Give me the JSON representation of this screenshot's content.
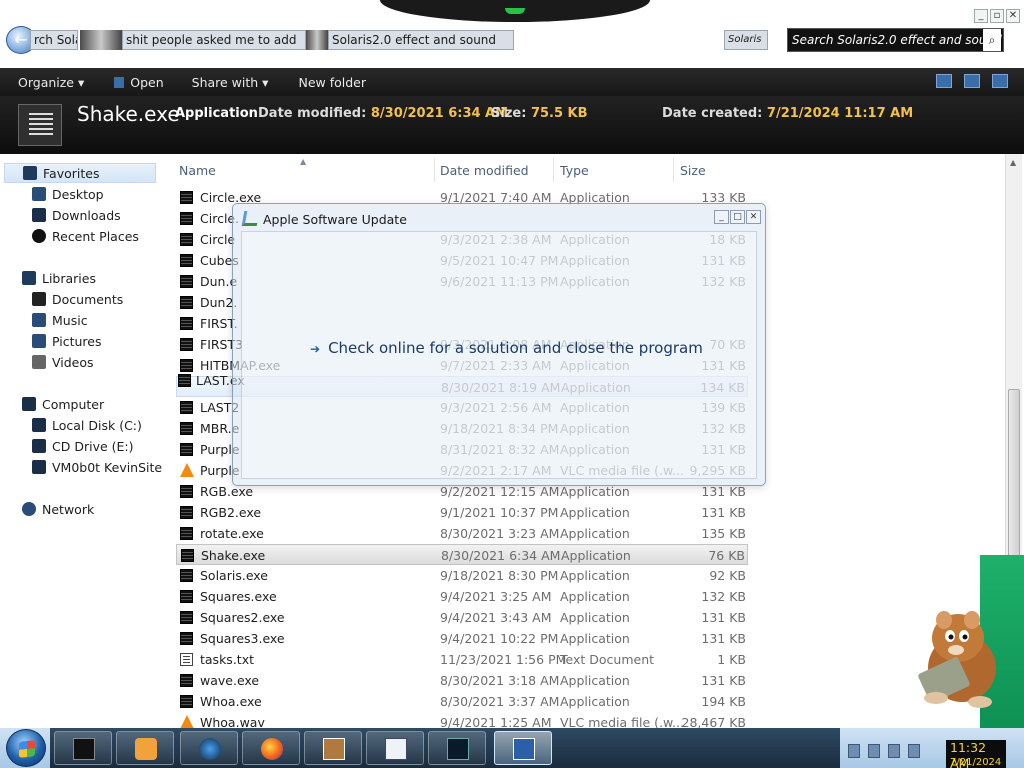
{
  "topbar": {
    "breadcrumb_left": "rch Sola",
    "breadcrumb_mid": "shit people asked me to add",
    "breadcrumb_right": "Solaris2.0 effect and sound",
    "breadcrumb_tag": "Solaris",
    "search_value": "Search Solaris2.0 effect and sound"
  },
  "toolbar": {
    "organize": "Organize ▾",
    "open": "Open",
    "share_with": "Share with ▾",
    "new_folder": "New folder"
  },
  "details": {
    "name": "Shake.exe",
    "type": "Application",
    "date_modified_label": "Date modified:",
    "date_modified": "8/30/2021 6:34 AM",
    "size_label": "Size:",
    "size": "75.5 KB",
    "date_created_label": "Date created:",
    "date_created": "7/21/2024 11:17 AM"
  },
  "nav": {
    "favorites": "Favorites",
    "desktop": "Desktop",
    "downloads": "Downloads",
    "recent": "Recent Places",
    "libraries": "Libraries",
    "documents": "Documents",
    "music": "Music",
    "pictures": "Pictures",
    "videos": "Videos",
    "computer": "Computer",
    "local_disk": "Local Disk (C:)",
    "cd_drive": "CD Drive (E:)",
    "vm": "VM0b0t KevinSite",
    "network": "Network"
  },
  "columns": {
    "name": "Name",
    "date": "Date modified",
    "type": "Type",
    "size": "Size"
  },
  "files": [
    {
      "name": "Circle.exe",
      "date": "9/1/2021 7:40 AM",
      "type": "Application",
      "size": "133 KB",
      "kind": "exe"
    },
    {
      "name": "Circle.",
      "date": "",
      "type": "",
      "size": "",
      "kind": "exe"
    },
    {
      "name": "Circle",
      "date": "9/3/2021 2:38 AM",
      "type": "Application",
      "size": "18 KB",
      "kind": "exe"
    },
    {
      "name": "Cubes",
      "date": "9/5/2021 10:47 PM",
      "type": "Application",
      "size": "131 KB",
      "kind": "exe"
    },
    {
      "name": "Dun.e",
      "date": "9/6/2021 11:13 PM",
      "type": "Application",
      "size": "132 KB",
      "kind": "exe"
    },
    {
      "name": "Dun2.",
      "date": "",
      "type": "",
      "size": "",
      "kind": "exe"
    },
    {
      "name": "FIRST.",
      "date": "",
      "type": "",
      "size": "",
      "kind": "exe"
    },
    {
      "name": "FIRST3",
      "date": "9/3/2021 8:08 AM",
      "type": "Application",
      "size": "70 KB",
      "kind": "exe"
    },
    {
      "name": "HITBMAP.exe",
      "date": "9/7/2021 2:33 AM",
      "type": "Application",
      "size": "131 KB",
      "kind": "exe"
    },
    {
      "name": "",
      "date": "8/30/2021 8:19 AM",
      "type": "Application",
      "size": "134 KB",
      "kind": "none"
    },
    {
      "name": "LAST2",
      "date": "9/3/2021 2:56 AM",
      "type": "Application",
      "size": "139 KB",
      "kind": "exe"
    },
    {
      "name": "MBR.e",
      "date": "9/18/2021 8:34 PM",
      "type": "Application",
      "size": "132 KB",
      "kind": "exe"
    },
    {
      "name": "Purple",
      "date": "8/31/2021 8:32 AM",
      "type": "Application",
      "size": "131 KB",
      "kind": "exe"
    },
    {
      "name": "Purple",
      "date": "9/2/2021 2:17 AM",
      "type": "VLC media file (.w...",
      "size": "9,295 KB",
      "kind": "vlc"
    },
    {
      "name": "RGB.exe",
      "date": "9/2/2021 12:15 AM",
      "type": "Application",
      "size": "131 KB",
      "kind": "exe"
    },
    {
      "name": "RGB2.exe",
      "date": "9/1/2021 10:37 PM",
      "type": "Application",
      "size": "131 KB",
      "kind": "exe"
    },
    {
      "name": "rotate.exe",
      "date": "8/30/2021 3:23 AM",
      "type": "Application",
      "size": "135 KB",
      "kind": "exe"
    },
    {
      "name": "Shake.exe",
      "date": "8/30/2021 6:34 AM",
      "type": "Application",
      "size": "76 KB",
      "kind": "exe"
    },
    {
      "name": "Solaris.exe",
      "date": "9/18/2021 8:30 PM",
      "type": "Application",
      "size": "92 KB",
      "kind": "exe"
    },
    {
      "name": "Squares.exe",
      "date": "9/4/2021 3:25 AM",
      "type": "Application",
      "size": "132 KB",
      "kind": "exe"
    },
    {
      "name": "Squares2.exe",
      "date": "9/4/2021 3:43 AM",
      "type": "Application",
      "size": "131 KB",
      "kind": "exe"
    },
    {
      "name": "Squares3.exe",
      "date": "9/4/2021 10:22 PM",
      "type": "Application",
      "size": "131 KB",
      "kind": "exe"
    },
    {
      "name": "tasks.txt",
      "date": "11/23/2021 1:56 PM",
      "type": "Text Document",
      "size": "1 KB",
      "kind": "txt"
    },
    {
      "name": "wave.exe",
      "date": "8/30/2021 3:18 AM",
      "type": "Application",
      "size": "131 KB",
      "kind": "exe"
    },
    {
      "name": "Whoa.exe",
      "date": "8/30/2021 3:37 AM",
      "type": "Application",
      "size": "194 KB",
      "kind": "exe"
    },
    {
      "name": "Whoa.wav",
      "date": "9/4/2021 1:25 AM",
      "type": "VLC media file (.w...",
      "size": "28,467 KB",
      "kind": "vlc"
    }
  ],
  "drag_ghost": "LAST.ex",
  "dialog": {
    "title": "Apple Software Update",
    "option": "Check online for a solution and close the program"
  },
  "tray": {
    "time": "11:32 AM",
    "date": "7/21/2024"
  }
}
